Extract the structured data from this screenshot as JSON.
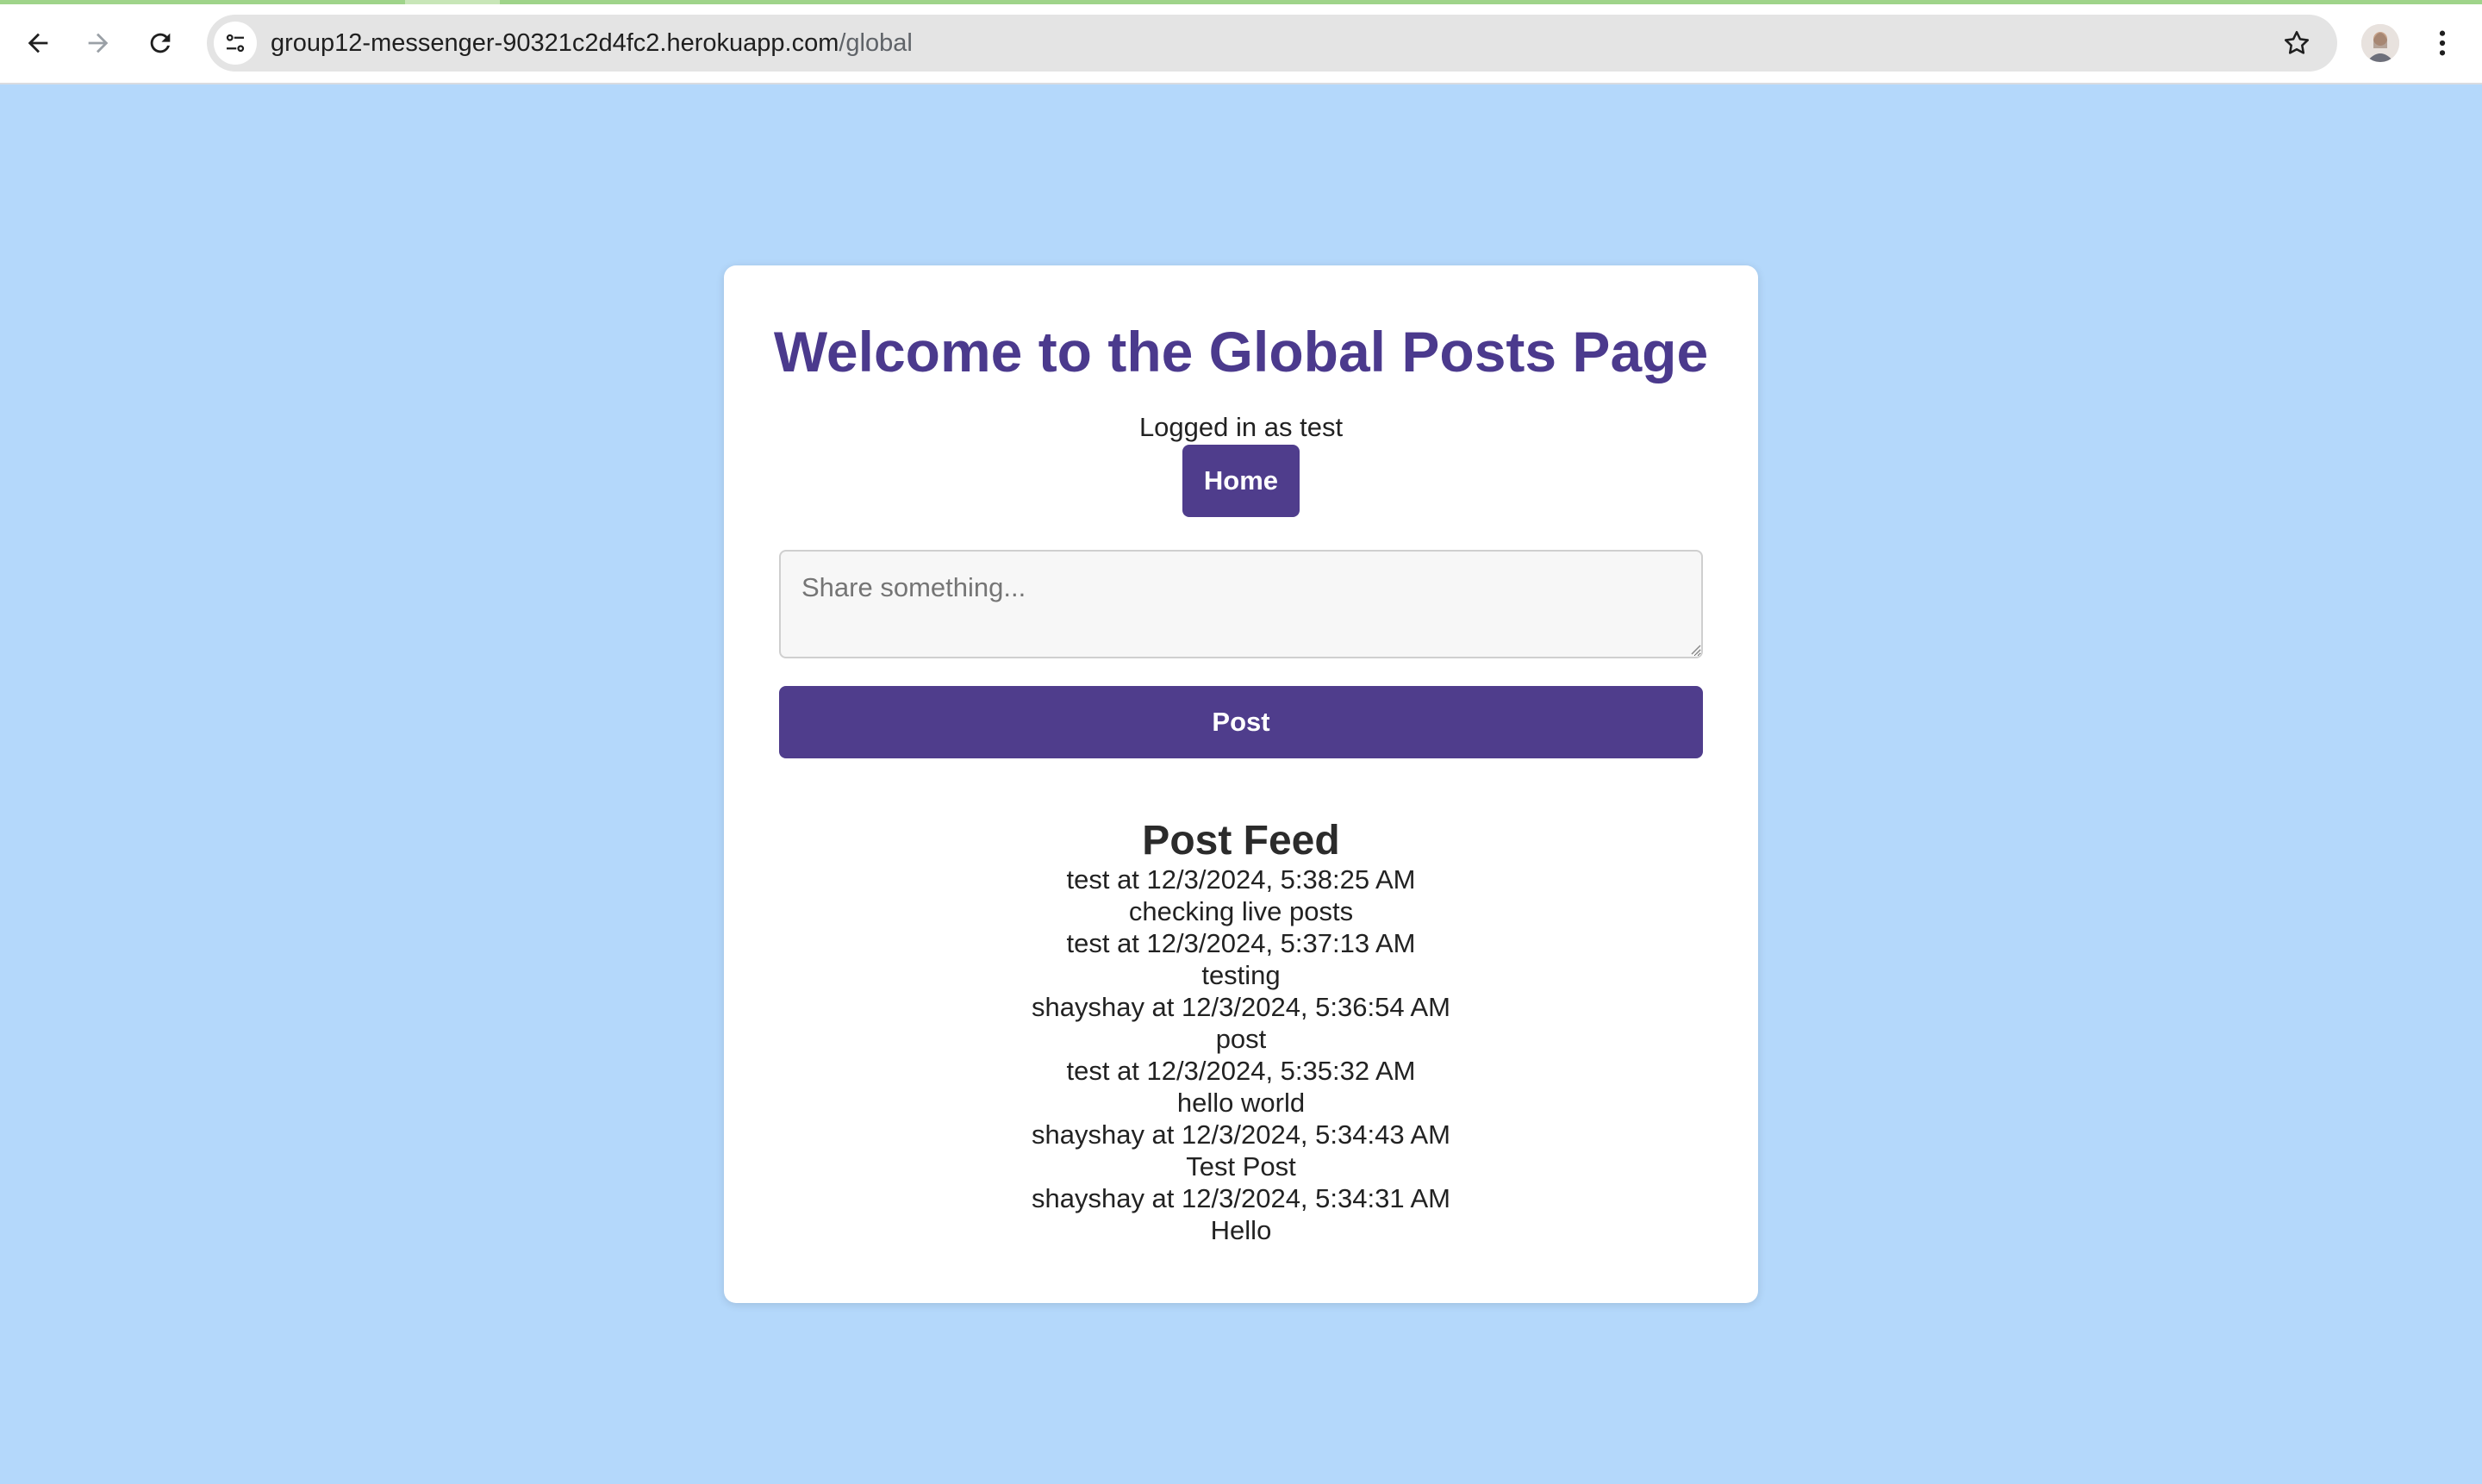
{
  "browser": {
    "url_host": "group12-messenger-90321c2d4fc2.herokuapp.com",
    "url_path": "/global",
    "icons": {
      "back": "arrow-left-icon",
      "forward": "arrow-right-icon",
      "reload": "reload-icon",
      "site_info": "tune-icon",
      "bookmark": "star-icon",
      "profile": "avatar",
      "menu": "kebab-menu-icon"
    }
  },
  "page": {
    "title": "Welcome to the Global Posts Page",
    "logged_in_text": "Logged in as test",
    "home_label": "Home",
    "share_placeholder": "Share something...",
    "post_label": "Post",
    "feed_title": "Post Feed",
    "posts": [
      {
        "meta": "test at 12/3/2024, 5:38:25 AM",
        "body": "checking live posts"
      },
      {
        "meta": "test at 12/3/2024, 5:37:13 AM",
        "body": "testing"
      },
      {
        "meta": "shayshay at 12/3/2024, 5:36:54 AM",
        "body": "post"
      },
      {
        "meta": "test at 12/3/2024, 5:35:32 AM",
        "body": "hello world"
      },
      {
        "meta": "shayshay at 12/3/2024, 5:34:43 AM",
        "body": "Test Post"
      },
      {
        "meta": "shayshay at 12/3/2024, 5:34:31 AM",
        "body": "Hello"
      }
    ]
  },
  "colors": {
    "background": "#b4d8fb",
    "accent": "#4f3d8c",
    "title": "#4b3a8d",
    "card": "#ffffff"
  }
}
